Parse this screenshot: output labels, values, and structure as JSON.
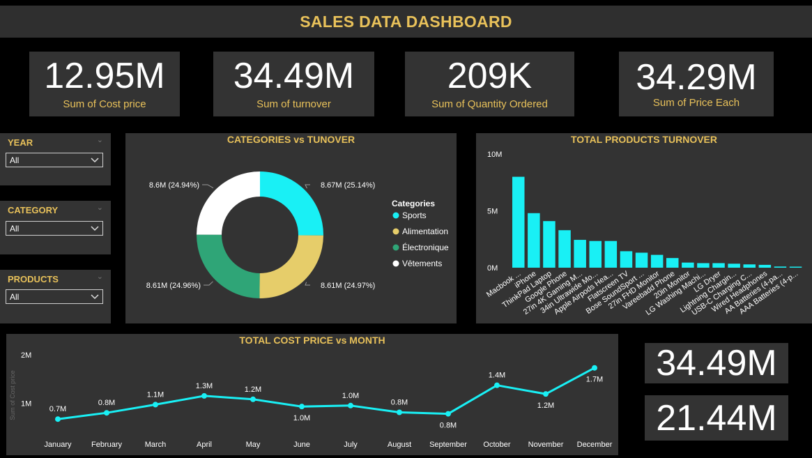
{
  "header": {
    "title": "SALES DATA DASHBOARD"
  },
  "kpis": [
    {
      "value": "12.95M",
      "label": "Sum of Cost price"
    },
    {
      "value": "34.49M",
      "label": "Sum of turnover"
    },
    {
      "value": "209K",
      "label": "Sum of Quantity Ordered"
    },
    {
      "value": "34.29M",
      "label": "Sum of Price Each"
    }
  ],
  "slicers": [
    {
      "title": "YEAR",
      "selected": "All"
    },
    {
      "title": "CATEGORY",
      "selected": "All"
    },
    {
      "title": "PRODUCTS",
      "selected": "All"
    }
  ],
  "colors": {
    "accent": "#e8c15a",
    "cyan": "#19f0f5",
    "panel": "#333333"
  },
  "chart_data": [
    {
      "type": "pie",
      "title": "CATEGORIES vs TUNOVER",
      "legend_title": "Categories",
      "legend_position": "right",
      "slices": [
        {
          "name": "Sports",
          "value": 8.67,
          "label": "8.67M (25.14%)",
          "color": "#19f0f5"
        },
        {
          "name": "Alimentation",
          "value": 8.61,
          "label": "8.61M (24.97%)",
          "color": "#e6cd6a"
        },
        {
          "name": "Électronique",
          "value": 8.61,
          "label": "8.61M (24.96%)",
          "color": "#2fa577"
        },
        {
          "name": "Vêtements",
          "value": 8.6,
          "label": "8.6M (24.94%)",
          "color": "#ffffff"
        }
      ]
    },
    {
      "type": "bar",
      "title": "TOTAL PRODUCTS TURNOVER",
      "yticks": [
        "10M",
        "5M",
        "0M"
      ],
      "ylim": [
        0,
        10
      ],
      "categories": [
        "Macbook ...",
        "iPhone",
        "ThinkPad Laptop",
        "Google Phone",
        "27in 4K Gaming M...",
        "34in Ultrawide Mo...",
        "Apple Airpods Hea...",
        "Flatscreen TV",
        "Bose SoundSport ...",
        "27in FHD Monitor",
        "Vareebadd Phone",
        "20in Monitor",
        "LG Washing Machi...",
        "LG Dryer",
        "Lightning Chargin...",
        "USB-C Charging C...",
        "Wired Headphones",
        "AA Batteries (4-pa...",
        "AAA Batteries (4-p..."
      ],
      "values": [
        8.0,
        4.8,
        4.1,
        3.3,
        2.45,
        2.35,
        2.35,
        1.45,
        1.32,
        1.13,
        0.85,
        0.45,
        0.4,
        0.4,
        0.35,
        0.29,
        0.25,
        0.1,
        0.09
      ]
    },
    {
      "type": "line",
      "title": "TOTAL COST PRICE vs MONTH",
      "ylabel": "Sum of Cost price",
      "yticks": [
        "2M",
        "1M"
      ],
      "ylim": [
        0.5,
        2.0
      ],
      "categories": [
        "January",
        "February",
        "March",
        "April",
        "May",
        "June",
        "July",
        "August",
        "September",
        "October",
        "November",
        "December"
      ],
      "values": [
        0.67,
        0.8,
        0.97,
        1.15,
        1.08,
        0.93,
        0.95,
        0.81,
        0.78,
        1.37,
        1.19,
        1.73
      ],
      "labels": [
        "0.7M",
        "0.8M",
        "1.1M",
        "1.3M",
        "1.2M",
        "1.0M",
        "1.0M",
        "0.8M",
        "0.8M",
        "1.4M",
        "1.2M",
        "1.7M"
      ]
    }
  ],
  "side_cards": [
    {
      "value": "34.49M"
    },
    {
      "value": "21.44M"
    }
  ]
}
